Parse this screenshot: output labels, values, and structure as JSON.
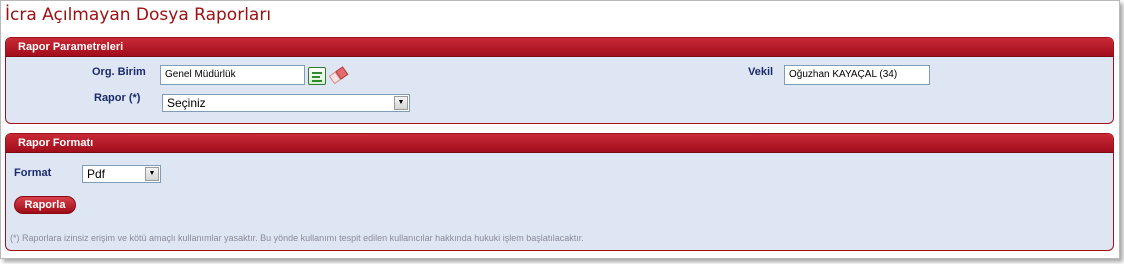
{
  "page": {
    "title": "İcra Açılmayan Dosya Raporları"
  },
  "params_panel": {
    "header": "Rapor Parametreleri",
    "org_label": "Org. Birim",
    "org_value": "Genel Müdürlük",
    "vekil_label": "Vekil",
    "vekil_value": "Oğuzhan KAYAÇAL (34)",
    "rapor_label": "Rapor (*)",
    "rapor_selected": "Seçiniz",
    "icons": [
      "list-icon",
      "eraser-icon"
    ]
  },
  "format_panel": {
    "header": "Rapor Formatı",
    "format_label": "Format",
    "format_selected": "Pdf",
    "button_label": "Raporla",
    "note": "(*) Raporlara izinsiz erişim ve kötü amaçlı kullanımlar yasaktır. Bu yönde kullanımı tespit edilen kullanıcılar hakkında hukuki işlem başlatılacaktır."
  }
}
